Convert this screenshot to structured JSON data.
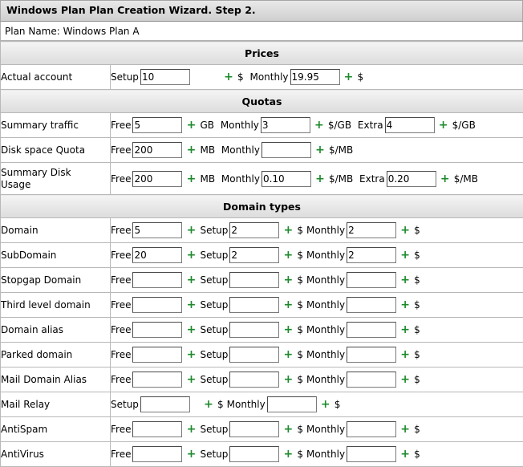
{
  "header": {
    "title": "Windows Plan Plan Creation Wizard. Step 2."
  },
  "plan": {
    "label": "Plan Name:",
    "value": "Windows Plan A"
  },
  "prices": {
    "title": "Prices",
    "actual_account": {
      "label": "Actual account",
      "setup_label": "Setup",
      "setup_value": "10",
      "setup_unit": "$",
      "monthly_label": "Monthly",
      "monthly_value": "19.95",
      "monthly_unit": "$"
    }
  },
  "quotas": {
    "title": "Quotas",
    "summary_traffic": {
      "label": "Summary traffic",
      "free_label": "Free",
      "free_value": "5",
      "free_unit": "GB",
      "monthly_label": "Monthly",
      "monthly_value": "3",
      "monthly_unit": "$/GB",
      "extra_label": "Extra",
      "extra_value": "4",
      "extra_unit": "$/GB"
    },
    "disk_space": {
      "label": "Disk space Quota",
      "free_label": "Free",
      "free_value": "200",
      "free_unit": "MB",
      "monthly_label": "Monthly",
      "monthly_value": "",
      "monthly_unit": "$/MB"
    },
    "summary_disk": {
      "label_line1": "Summary Disk",
      "label_line2": "Usage",
      "free_label": "Free",
      "free_value": "200",
      "free_unit": "MB",
      "monthly_label": "Monthly",
      "monthly_value": "0.10",
      "monthly_unit": "$/MB",
      "extra_label": "Extra",
      "extra_value": "0.20",
      "extra_unit": "$/MB"
    }
  },
  "domain_types": {
    "title": "Domain types",
    "free_label": "Free",
    "setup_label": "Setup",
    "monthly_label": "Monthly",
    "currency": "$",
    "rows": [
      {
        "label": "Domain",
        "free": "5",
        "setup": "2",
        "monthly": "2"
      },
      {
        "label": "SubDomain",
        "free": "20",
        "setup": "2",
        "monthly": "2"
      },
      {
        "label": "Stopgap Domain",
        "free": "",
        "setup": "",
        "monthly": ""
      },
      {
        "label": "Third level domain",
        "free": "",
        "setup": "",
        "monthly": ""
      },
      {
        "label": "Domain alias",
        "free": "",
        "setup": "",
        "monthly": ""
      },
      {
        "label": "Parked domain",
        "free": "",
        "setup": "",
        "monthly": ""
      },
      {
        "label": "Mail Domain Alias",
        "free": "",
        "setup": "",
        "monthly": ""
      },
      {
        "label": "Mail Relay",
        "setup": "",
        "monthly": ""
      },
      {
        "label": "AntiSpam",
        "free": "",
        "setup": "",
        "monthly": ""
      },
      {
        "label": "AntiVirus",
        "free": "",
        "setup": "",
        "monthly": ""
      }
    ]
  },
  "icons": {
    "plus": "+"
  },
  "colors": {
    "plus": "#1b8a2b",
    "header_bg": "#d9d9d9",
    "border": "#b8b8b8"
  }
}
